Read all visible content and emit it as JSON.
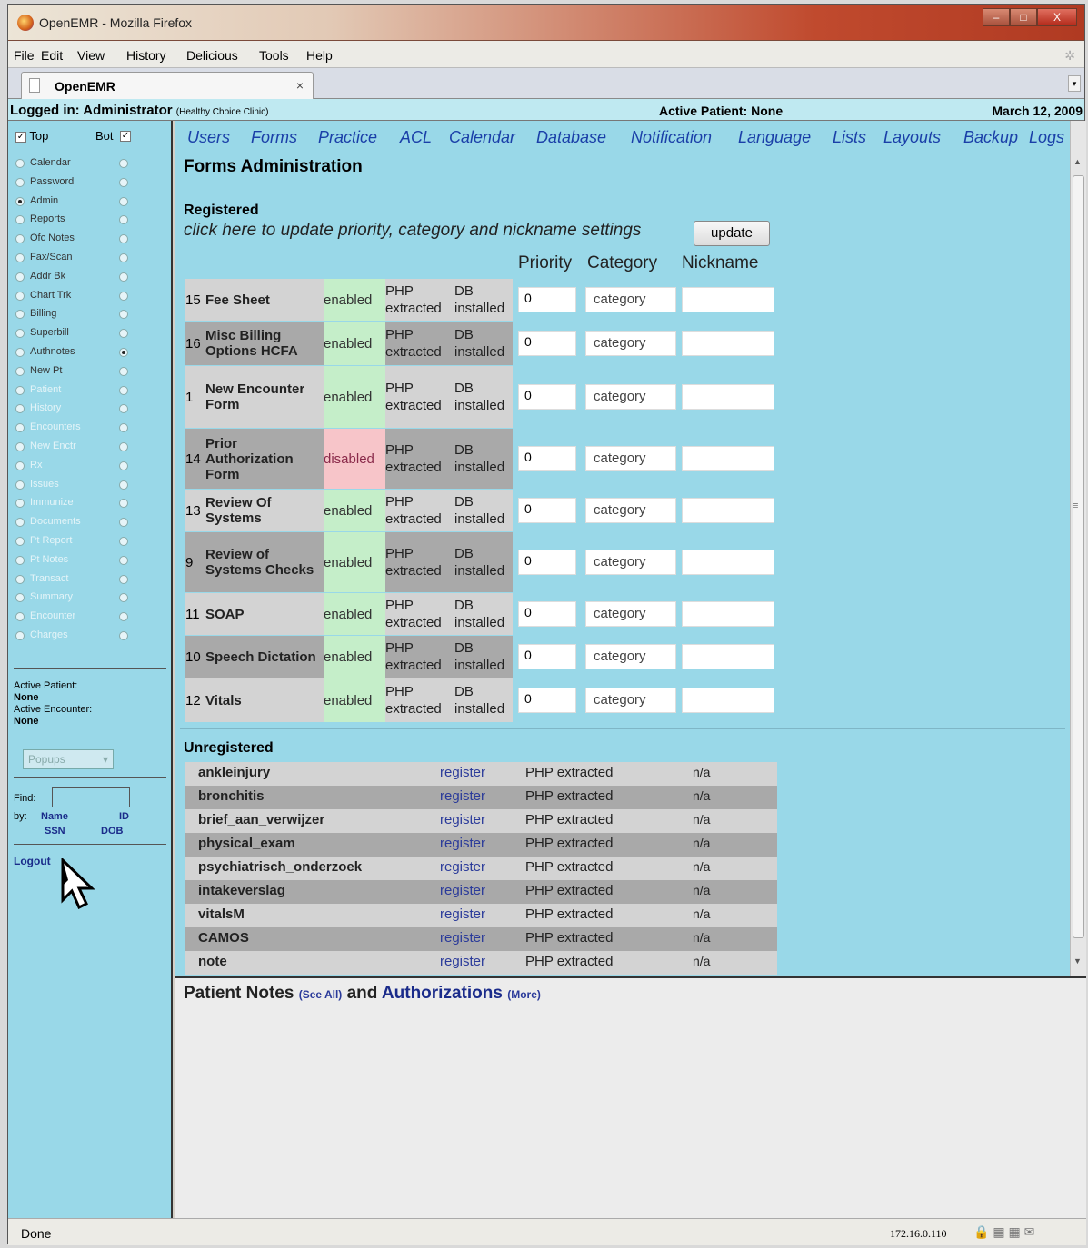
{
  "window": {
    "title": "OpenEMR - Mozilla Firefox",
    "min": "–",
    "max": "□",
    "close": "X"
  },
  "menu": [
    "File",
    "Edit",
    "View",
    "History",
    "Delicious",
    "Tools",
    "Help"
  ],
  "tab": {
    "label": "OpenEMR",
    "close": "×"
  },
  "header": {
    "logged_in": "Logged in: Administrator",
    "clinic": "(Healthy Choice Clinic)",
    "active_patient": "Active Patient: None",
    "date": "March 12, 2009"
  },
  "sidebar": {
    "top": "Top",
    "bot": "Bot",
    "items": [
      {
        "label": "Calendar",
        "active": true
      },
      {
        "label": "Password",
        "active": true
      },
      {
        "label": "Admin",
        "active": true
      },
      {
        "label": "Reports",
        "active": true
      },
      {
        "label": "Ofc Notes",
        "active": true
      },
      {
        "label": "Fax/Scan",
        "active": true
      },
      {
        "label": "Addr Bk",
        "active": true
      },
      {
        "label": "Chart Trk",
        "active": true
      },
      {
        "label": "Billing",
        "active": true
      },
      {
        "label": "Superbill",
        "active": true
      },
      {
        "label": "Authnotes",
        "active": true
      },
      {
        "label": "New Pt",
        "active": true
      },
      {
        "label": "Patient",
        "active": false
      },
      {
        "label": "History",
        "active": false
      },
      {
        "label": "Encounters",
        "active": false
      },
      {
        "label": "New Enctr",
        "active": false
      },
      {
        "label": "Rx",
        "active": false
      },
      {
        "label": "Issues",
        "active": false
      },
      {
        "label": "Immunize",
        "active": false
      },
      {
        "label": "Documents",
        "active": false
      },
      {
        "label": "Pt Report",
        "active": false
      },
      {
        "label": "Pt Notes",
        "active": false
      },
      {
        "label": "Transact",
        "active": false
      },
      {
        "label": "Summary",
        "active": false
      },
      {
        "label": "Encounter",
        "active": false
      },
      {
        "label": "Charges",
        "active": false
      }
    ],
    "active_patient_label": "Active Patient:",
    "active_patient_value": "None",
    "active_encounter_label": "Active Encounter:",
    "active_encounter_value": "None",
    "popups_placeholder": "Popups",
    "find_label": "Find:",
    "by_label": "by:",
    "find_name": "Name",
    "find_id": "ID",
    "find_ssn": "SSN",
    "find_dob": "DOB",
    "logout": "Logout"
  },
  "admin_nav": [
    "Users",
    "Forms",
    "Practice",
    "ACL",
    "Calendar",
    "Database",
    "Notification",
    "Language",
    "Lists",
    "Layouts",
    "Backup",
    "Logs"
  ],
  "forms": {
    "title": "Forms Administration",
    "registered_heading": "Registered",
    "instructions": "click here to update priority, category and nickname settings",
    "update_button": "update",
    "col_priority": "Priority",
    "col_category": "Category",
    "col_nickname": "Nickname",
    "registered": [
      {
        "num": "15",
        "name": "Fee Sheet",
        "status": "enabled",
        "php": "PHP extracted",
        "db": "DB installed",
        "priority": "0",
        "category": "category",
        "nickname": ""
      },
      {
        "num": "16",
        "name": "Misc Billing Options HCFA",
        "status": "enabled",
        "php": "PHP extracted",
        "db": "DB installed",
        "priority": "0",
        "category": "category",
        "nickname": ""
      },
      {
        "num": "1",
        "name": "New Encounter Form",
        "status": "enabled",
        "php": "PHP extracted",
        "db": "DB installed",
        "priority": "0",
        "category": "category",
        "nickname": ""
      },
      {
        "num": "14",
        "name": "Prior Authorization Form",
        "status": "disabled",
        "php": "PHP extracted",
        "db": "DB installed",
        "priority": "0",
        "category": "category",
        "nickname": ""
      },
      {
        "num": "13",
        "name": "Review Of Systems",
        "status": "enabled",
        "php": "PHP extracted",
        "db": "DB installed",
        "priority": "0",
        "category": "category",
        "nickname": ""
      },
      {
        "num": "9",
        "name": "Review of Systems Checks",
        "status": "enabled",
        "php": "PHP extracted",
        "db": "DB installed",
        "priority": "0",
        "category": "category",
        "nickname": ""
      },
      {
        "num": "11",
        "name": "SOAP",
        "status": "enabled",
        "php": "PHP extracted",
        "db": "DB installed",
        "priority": "0",
        "category": "category",
        "nickname": ""
      },
      {
        "num": "10",
        "name": "Speech Dictation",
        "status": "enabled",
        "php": "PHP extracted",
        "db": "DB installed",
        "priority": "0",
        "category": "category",
        "nickname": ""
      },
      {
        "num": "12",
        "name": "Vitals",
        "status": "enabled",
        "php": "PHP extracted",
        "db": "DB installed",
        "priority": "0",
        "category": "category",
        "nickname": ""
      }
    ],
    "unregistered_heading": "Unregistered",
    "unregistered": [
      {
        "name": "ankleinjury",
        "action": "register",
        "php": "PHP extracted",
        "db": "n/a"
      },
      {
        "name": "bronchitis",
        "action": "register",
        "php": "PHP extracted",
        "db": "n/a"
      },
      {
        "name": "brief_aan_verwijzer",
        "action": "register",
        "php": "PHP extracted",
        "db": "n/a"
      },
      {
        "name": "physical_exam",
        "action": "register",
        "php": "PHP extracted",
        "db": "n/a"
      },
      {
        "name": "psychiatrisch_onderzoek",
        "action": "register",
        "php": "PHP extracted",
        "db": "n/a"
      },
      {
        "name": "intakeverslag",
        "action": "register",
        "php": "PHP extracted",
        "db": "n/a"
      },
      {
        "name": "vitalsM",
        "action": "register",
        "php": "PHP extracted",
        "db": "n/a"
      },
      {
        "name": "CAMOS",
        "action": "register",
        "php": "PHP extracted",
        "db": "n/a"
      },
      {
        "name": "note",
        "action": "register",
        "php": "PHP extracted",
        "db": "n/a"
      }
    ]
  },
  "notes": {
    "title1": "Patient Notes",
    "see_all": "(See All)",
    "and": "and",
    "title2": "Authorizations",
    "more": "(More)"
  },
  "status_bar": {
    "text": "Done",
    "ip": "172.16.0.110"
  },
  "colors": {
    "main_bg": "#99d8e8",
    "enabled_bg": "#c5eec9",
    "disabled_bg": "#f7c5c9",
    "link_blue": "#1a3fa8"
  }
}
